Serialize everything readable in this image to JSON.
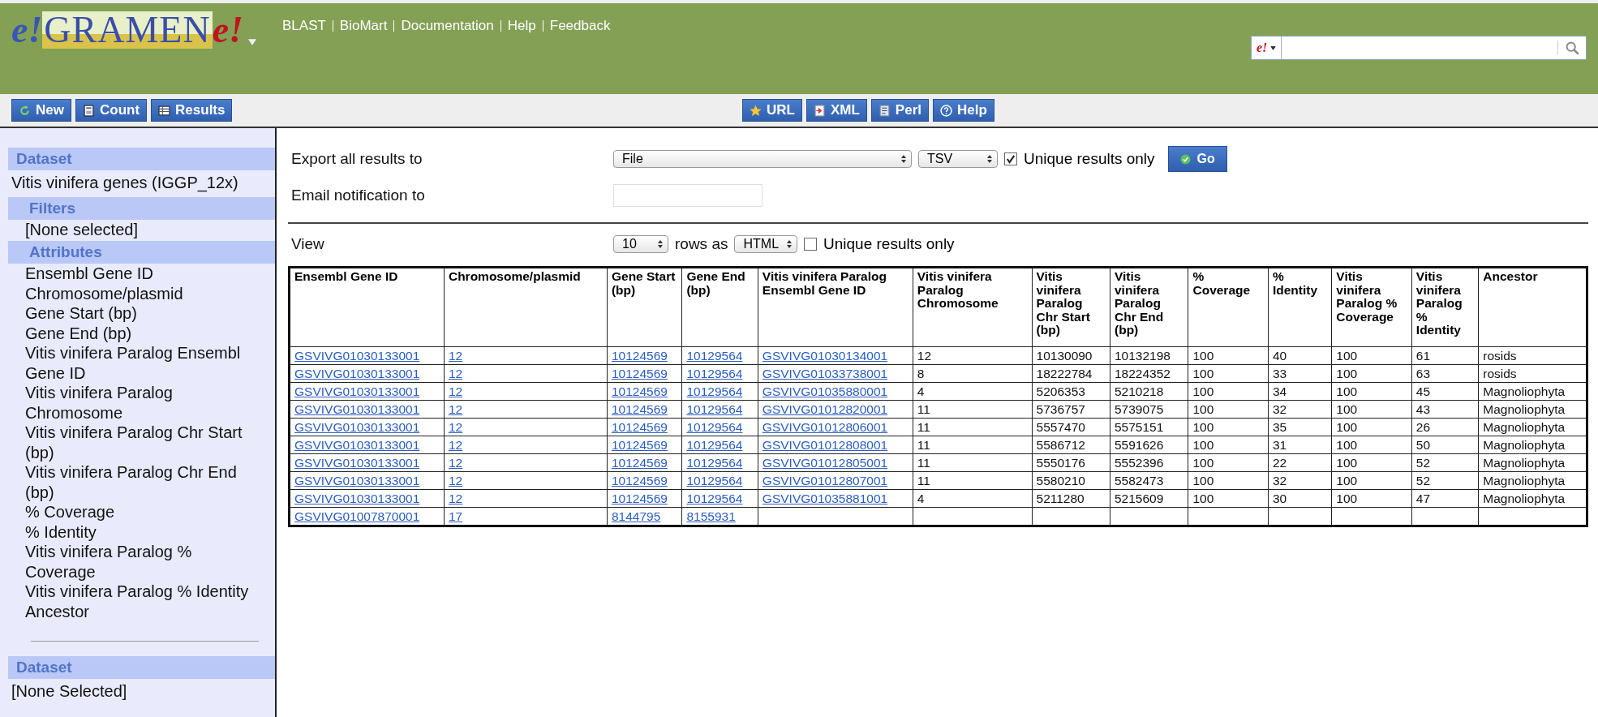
{
  "logo": {
    "prefix": "e!",
    "name": "GRAMEN",
    "suffix": "e!"
  },
  "top_links": [
    "BLAST",
    "BioMart",
    "Documentation",
    "Help",
    "Feedback"
  ],
  "search": {
    "scope": "e!"
  },
  "toolbar_left": [
    "New",
    "Count",
    "Results"
  ],
  "toolbar_center": [
    "URL",
    "XML",
    "Perl",
    "Help"
  ],
  "sidebar": {
    "sections": [
      {
        "heading": "Dataset",
        "kind": "main",
        "items": [
          "Vitis vinifera genes (IGGP_12x)"
        ]
      },
      {
        "heading": "Filters",
        "kind": "sub",
        "items": [
          "[None selected]"
        ]
      },
      {
        "heading": "Attributes",
        "kind": "sub",
        "items": [
          "Ensembl Gene ID",
          "Chromosome/plasmid",
          "Gene Start (bp)",
          "Gene End (bp)",
          "Vitis vinifera Paralog Ensembl Gene ID",
          "Vitis vinifera Paralog Chromosome",
          "Vitis vinifera Paralog Chr Start (bp)",
          "Vitis vinifera Paralog Chr End (bp)",
          "% Coverage",
          "% Identity",
          "Vitis vinifera Paralog % Coverage",
          "Vitis vinifera Paralog % Identity",
          "Ancestor"
        ]
      }
    ],
    "second": {
      "heading": "Dataset",
      "items": [
        "[None Selected]"
      ]
    }
  },
  "export": {
    "label": "Export  all results to",
    "destination": "File",
    "format": "TSV",
    "unique_label": "Unique results only",
    "unique_checked": true,
    "go": "Go"
  },
  "email": {
    "label": "Email notification to"
  },
  "view": {
    "label": "View",
    "rows": "10",
    "rows_as": "rows as",
    "format": "HTML",
    "unique_label": "Unique results only",
    "unique_checked": false
  },
  "table": {
    "columns": [
      {
        "label": "Ensembl Gene ID",
        "kind": "link"
      },
      {
        "label": "Chromosome/plasmid",
        "kind": "link"
      },
      {
        "label": "Gene Start (bp)",
        "kind": "link"
      },
      {
        "label": "Gene End (bp)",
        "kind": "link"
      },
      {
        "label": "Vitis vinifera Paralog Ensembl Gene ID",
        "kind": "link"
      },
      {
        "label": "Vitis vinifera Paralog Chromosome",
        "kind": "text"
      },
      {
        "label": "Vitis vinifera Paralog Chr Start (bp)",
        "kind": "text"
      },
      {
        "label": "Vitis vinifera Paralog Chr End (bp)",
        "kind": "text"
      },
      {
        "label": "% Coverage",
        "kind": "text"
      },
      {
        "label": "% Identity",
        "kind": "text"
      },
      {
        "label": "Vitis vinifera Paralog % Coverage",
        "kind": "text"
      },
      {
        "label": "Vitis vinifera Paralog % Identity",
        "kind": "text"
      },
      {
        "label": "Ancestor",
        "kind": "text"
      }
    ],
    "rows": [
      [
        "GSVIVG01030133001",
        "12",
        "10124569",
        "10129564",
        "GSVIVG01030134001",
        "12",
        "10130090",
        "10132198",
        "100",
        "40",
        "100",
        "61",
        "rosids"
      ],
      [
        "GSVIVG01030133001",
        "12",
        "10124569",
        "10129564",
        "GSVIVG01033738001",
        "8",
        "18222784",
        "18224352",
        "100",
        "33",
        "100",
        "63",
        "rosids"
      ],
      [
        "GSVIVG01030133001",
        "12",
        "10124569",
        "10129564",
        "GSVIVG01035880001",
        "4",
        "5206353",
        "5210218",
        "100",
        "34",
        "100",
        "45",
        "Magnoliophyta"
      ],
      [
        "GSVIVG01030133001",
        "12",
        "10124569",
        "10129564",
        "GSVIVG01012820001",
        "11",
        "5736757",
        "5739075",
        "100",
        "32",
        "100",
        "43",
        "Magnoliophyta"
      ],
      [
        "GSVIVG01030133001",
        "12",
        "10124569",
        "10129564",
        "GSVIVG01012806001",
        "11",
        "5557470",
        "5575151",
        "100",
        "35",
        "100",
        "26",
        "Magnoliophyta"
      ],
      [
        "GSVIVG01030133001",
        "12",
        "10124569",
        "10129564",
        "GSVIVG01012808001",
        "11",
        "5586712",
        "5591626",
        "100",
        "31",
        "100",
        "50",
        "Magnoliophyta"
      ],
      [
        "GSVIVG01030133001",
        "12",
        "10124569",
        "10129564",
        "GSVIVG01012805001",
        "11",
        "5550176",
        "5552396",
        "100",
        "22",
        "100",
        "52",
        "Magnoliophyta"
      ],
      [
        "GSVIVG01030133001",
        "12",
        "10124569",
        "10129564",
        "GSVIVG01012807001",
        "11",
        "5580210",
        "5582473",
        "100",
        "32",
        "100",
        "52",
        "Magnoliophyta"
      ],
      [
        "GSVIVG01030133001",
        "12",
        "10124569",
        "10129564",
        "GSVIVG01035881001",
        "4",
        "5211280",
        "5215609",
        "100",
        "30",
        "100",
        "47",
        "Magnoliophyta"
      ],
      [
        "GSVIVG01007870001",
        "17",
        "8144795",
        "8155931"
      ]
    ]
  }
}
